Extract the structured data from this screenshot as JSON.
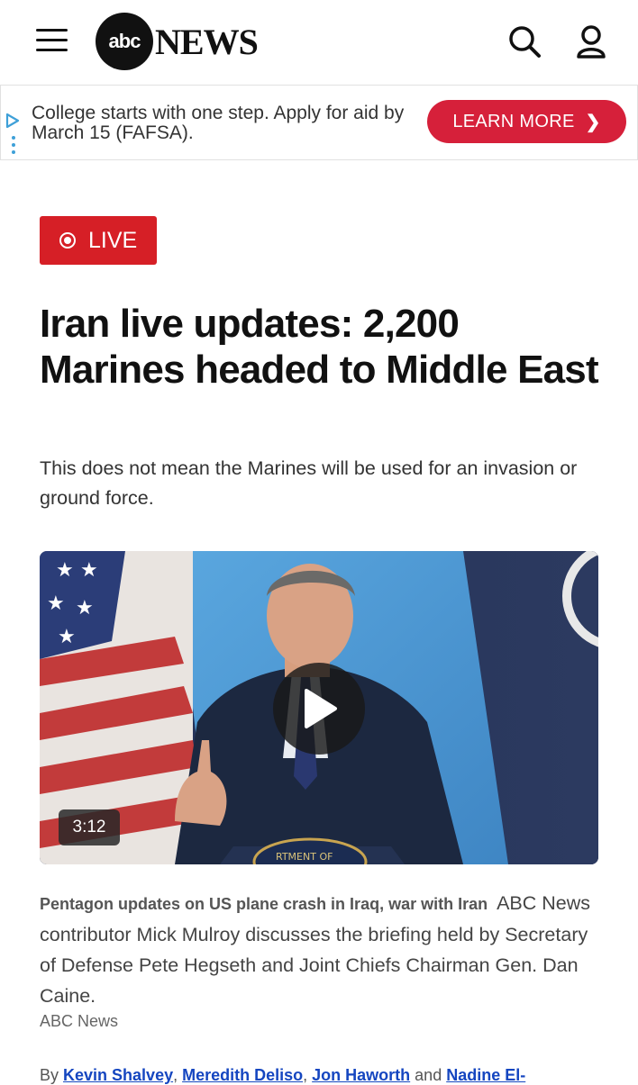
{
  "header": {
    "logo_abc": "abc",
    "logo_news": "NEWS",
    "menu_icon": "hamburger-icon",
    "search_icon": "search-icon",
    "account_icon": "user-icon"
  },
  "ad": {
    "text": "College starts with one step. Apply for aid by March 15 (FAFSA).",
    "button_label": "LEARN MORE",
    "button_color": "#d6203a"
  },
  "live_badge": {
    "label": "LIVE",
    "color": "#d61f26"
  },
  "article": {
    "headline": "Iran live updates: 2,200 Marines headed to Middle East",
    "dek": "This does not mean the Marines will be used for an invasion or ground force."
  },
  "video": {
    "duration": "3:12",
    "podium_text": "RTMENT OF",
    "caption_title": "Pentagon updates on US plane crash in Iraq, war with Iran",
    "caption_body": "ABC News contributor Mick Mulroy discusses the briefing held by Secretary of Defense Pete Hegseth and Joint Chiefs Chairman Gen. Dan Caine.",
    "credit": "ABC News"
  },
  "byline": {
    "prefix": "By",
    "authors": [
      "Kevin Shalvey",
      "Meredith Deliso",
      "Jon Haworth",
      "Nadine El-"
    ],
    "link_color": "#1546c0"
  }
}
